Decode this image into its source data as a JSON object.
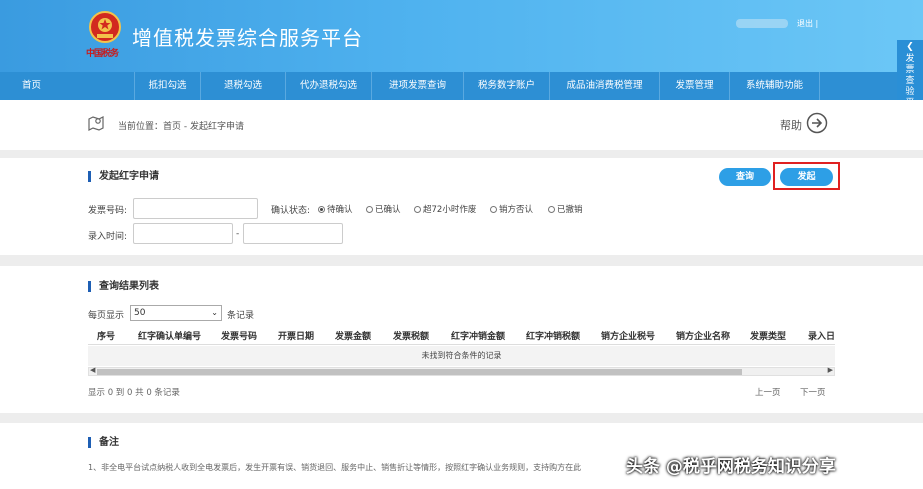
{
  "header": {
    "site_title": "增值税发票综合服务平台",
    "emblem_text": "中国税务",
    "logout": "退出 |"
  },
  "nav": {
    "items": [
      {
        "label": "首页"
      },
      {
        "label": "抵扣勾选"
      },
      {
        "label": "退税勾选"
      },
      {
        "label": "代办退税勾选"
      },
      {
        "label": "进项发票查询"
      },
      {
        "label": "税务数字账户"
      },
      {
        "label": "成品油消费税管理"
      },
      {
        "label": "发票管理"
      },
      {
        "label": "系统辅助功能"
      }
    ]
  },
  "side_tab": {
    "label": "发票查验平台"
  },
  "breadcrumb": {
    "text": "当前位置：首页 - 发起红字申请",
    "help": "帮助"
  },
  "apply_panel": {
    "title": "发起红字申请",
    "query_button": "查询",
    "submit_button": "发起",
    "invoice_no_label": "发票号码:",
    "invoice_no_value": "",
    "status_label": "确认状态:",
    "status_options": [
      {
        "label": "待确认",
        "selected": true
      },
      {
        "label": "已确认",
        "selected": false
      },
      {
        "label": "超72小时作废",
        "selected": false
      },
      {
        "label": "销方否认",
        "selected": false
      },
      {
        "label": "已撤销",
        "selected": false
      }
    ],
    "entry_time_label": "录入时间:",
    "date_separator": "-",
    "date_from": "",
    "date_to": ""
  },
  "results_panel": {
    "title": "查询结果列表",
    "page_size_prefix": "每页显示",
    "page_size": "50",
    "page_size_suffix": "条记录",
    "columns": [
      "序号",
      "红字确认单编号",
      "发票号码",
      "开票日期",
      "发票金额",
      "发票税额",
      "红字冲销金额",
      "红字冲销税额",
      "销方企业税号",
      "销方企业名称",
      "发票类型",
      "录入日"
    ],
    "empty_message": "未找到符合条件的记录",
    "summary": "显示 0 到 0 共 0 条记录",
    "prev": "上一页",
    "next": "下一页"
  },
  "notes_panel": {
    "title": "备注",
    "line1": "1、非全电平台试点纳税人收到全电发票后，发生开票有误、销货退回、服务中止、销售折让等情形，按照红字确认业务规则，支持购方在此"
  },
  "watermark": "头条 @税乎网税务知识分享",
  "colors": {
    "nav_bg": "#2d8fd4",
    "button": "#2d9fe6",
    "highlight": "#e02020",
    "title_bar": "#1e5fb4"
  }
}
